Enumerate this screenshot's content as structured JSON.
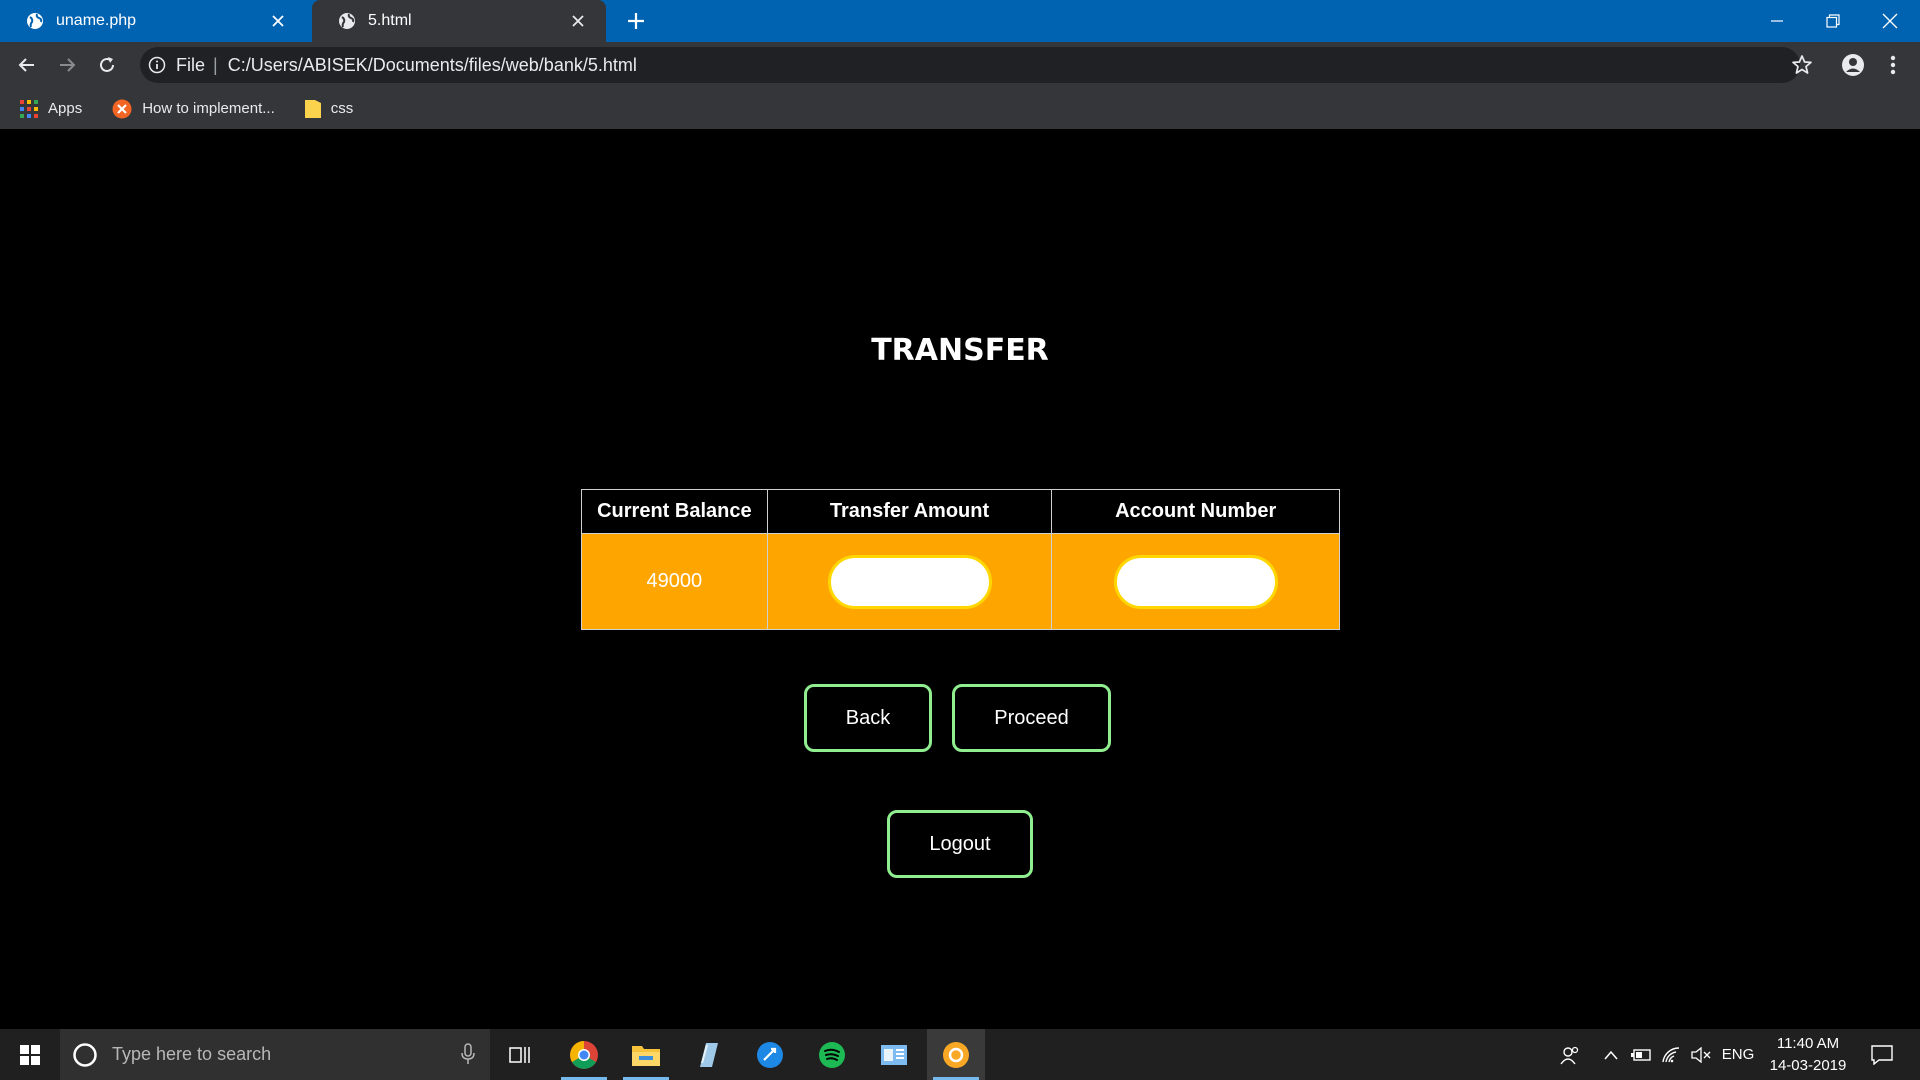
{
  "browser": {
    "tabs": [
      {
        "label": "uname.php",
        "active": false
      },
      {
        "label": "5.html",
        "active": true
      }
    ],
    "address": {
      "scheme_label": "File",
      "separator": "|",
      "url": "C:/Users/ABISEK/Documents/files/web/bank/5.html"
    },
    "bookmarks": [
      {
        "label": "Apps",
        "icon": "apps-grid-icon"
      },
      {
        "label": "How to implement...",
        "icon": "site-favicon-icon"
      },
      {
        "label": "css",
        "icon": "folder-icon"
      }
    ]
  },
  "page": {
    "title": "TRANSFER",
    "table": {
      "headers": [
        "Current Balance",
        "Transfer Amount",
        "Account Number"
      ],
      "current_balance": "49000",
      "transfer_amount_value": "",
      "account_number_value": ""
    },
    "buttons": {
      "back": "Back",
      "proceed": "Proceed",
      "logout": "Logout"
    },
    "colors": {
      "row_background": "#ffa500",
      "button_border": "#90ee90",
      "input_border": "#ffd700"
    }
  },
  "taskbar": {
    "search_placeholder": "Type here to search",
    "language": "ENG",
    "time": "11:40 AM",
    "date": "14-03-2019"
  }
}
